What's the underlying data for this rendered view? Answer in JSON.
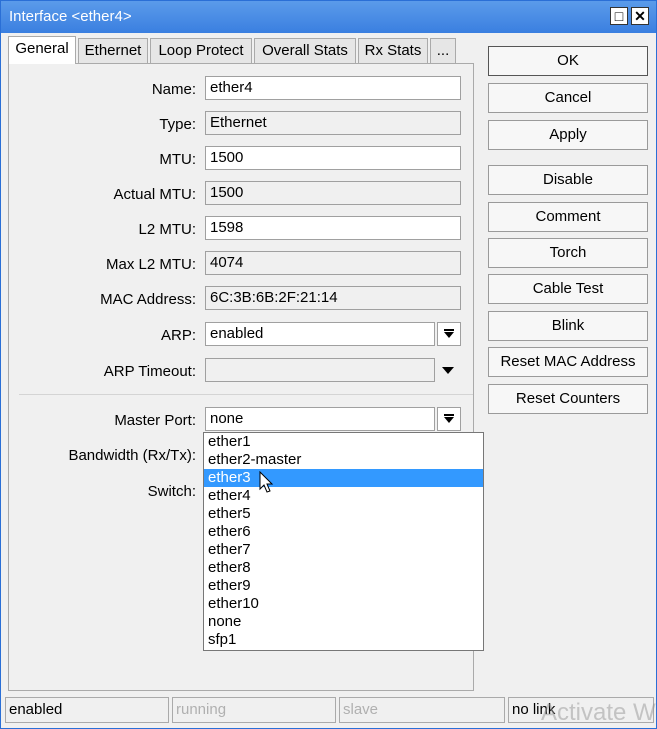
{
  "window": {
    "title": "Interface <ether4>",
    "max_glyph": "□",
    "close_glyph": "✕"
  },
  "tabs": [
    {
      "label": "General"
    },
    {
      "label": "Ethernet"
    },
    {
      "label": "Loop Protect"
    },
    {
      "label": "Overall Stats"
    },
    {
      "label": "Rx Stats"
    },
    {
      "label": "..."
    }
  ],
  "form": {
    "name": {
      "label": "Name:",
      "value": "ether4"
    },
    "type": {
      "label": "Type:",
      "value": "Ethernet"
    },
    "mtu": {
      "label": "MTU:",
      "value": "1500"
    },
    "actual_mtu": {
      "label": "Actual MTU:",
      "value": "1500"
    },
    "l2_mtu": {
      "label": "L2 MTU:",
      "value": "1598"
    },
    "max_l2_mtu": {
      "label": "Max L2 MTU:",
      "value": "4074"
    },
    "mac_address": {
      "label": "MAC Address:",
      "value": "6C:3B:6B:2F:21:14"
    },
    "arp": {
      "label": "ARP:",
      "value": "enabled"
    },
    "arp_timeout": {
      "label": "ARP Timeout:",
      "value": ""
    },
    "master_port": {
      "label": "Master Port:",
      "value": "none"
    },
    "bandwidth": {
      "label": "Bandwidth (Rx/Tx):"
    },
    "switch": {
      "label": "Switch:"
    }
  },
  "dropdown": {
    "items": [
      "ether1",
      "ether2-master",
      "ether3",
      "ether4",
      "ether5",
      "ether6",
      "ether7",
      "ether8",
      "ether9",
      "ether10",
      "none",
      "sfp1"
    ],
    "selected": "ether3"
  },
  "buttons": {
    "ok": "OK",
    "cancel": "Cancel",
    "apply": "Apply",
    "disable": "Disable",
    "comment": "Comment",
    "torch": "Torch",
    "cable_test": "Cable Test",
    "blink": "Blink",
    "reset_mac": "Reset MAC Address",
    "reset_counters": "Reset Counters"
  },
  "status_bar": {
    "s1": "enabled",
    "s2": "running",
    "s3": "slave",
    "s4": "no link"
  },
  "watermark": "Activate W",
  "colors": {
    "titlebar": "#3a7fe0",
    "selection": "#3399ff"
  }
}
